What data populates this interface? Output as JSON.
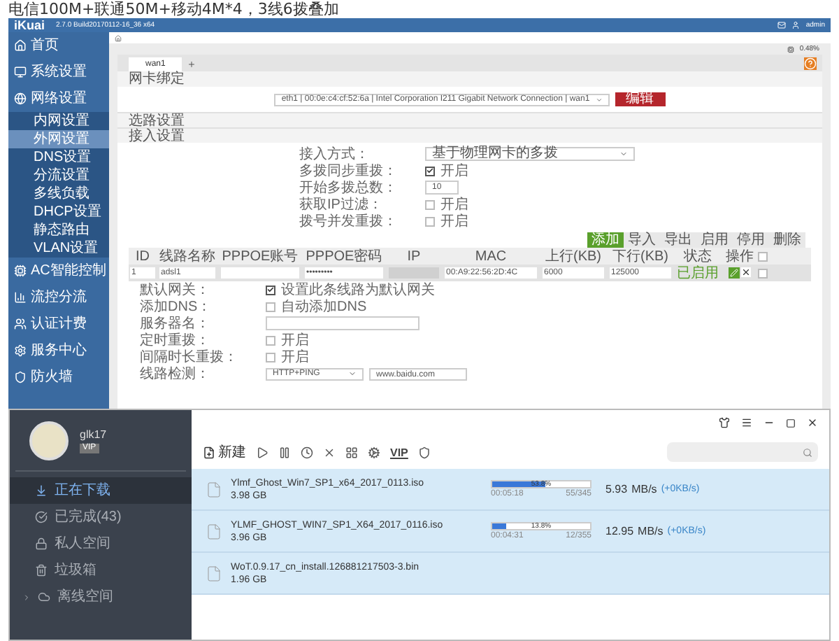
{
  "caption": "电信100M+联通50M+移动4M*4，3线6拨叠加",
  "router": {
    "header": {
      "logo": "iKuai",
      "version": "2.7.0 Build20170112-16_36 x64",
      "user": "admin"
    },
    "sidebar": [
      {
        "label": "首页",
        "kind": "main",
        "selected": false
      },
      {
        "label": "系统设置",
        "kind": "main",
        "selected": false
      },
      {
        "label": "网络设置",
        "kind": "main",
        "selected": false
      },
      {
        "label": "内网设置",
        "kind": "sub",
        "selected": false
      },
      {
        "label": "外网设置",
        "kind": "sub",
        "selected": true
      },
      {
        "label": "DNS设置",
        "kind": "sub",
        "selected": false
      },
      {
        "label": "分流设置",
        "kind": "sub",
        "selected": false
      },
      {
        "label": "多线负载",
        "kind": "sub",
        "selected": false
      },
      {
        "label": "DHCP设置",
        "kind": "sub",
        "selected": false
      },
      {
        "label": "静态路由",
        "kind": "sub",
        "selected": false
      },
      {
        "label": "VLAN设置",
        "kind": "sub",
        "selected": false
      },
      {
        "label": "AC智能控制",
        "kind": "main",
        "selected": false
      },
      {
        "label": "流控分流",
        "kind": "main",
        "selected": false
      },
      {
        "label": "认证计费",
        "kind": "main",
        "selected": false
      },
      {
        "label": "服务中心",
        "kind": "main",
        "selected": false
      },
      {
        "label": "防火墙",
        "kind": "main",
        "selected": false
      }
    ],
    "stats": {
      "cpu": "0.48%"
    },
    "tabs": [
      {
        "label": "wan1",
        "selected": true
      }
    ],
    "binding": {
      "title": "网卡绑定",
      "select": "eth1 | 00:0e:c4:cf:52:6a | Intel Corporation I211 Gigabit Network Connection | wan1",
      "button": "编辑"
    },
    "sections": [
      "选路设置",
      "接入设置"
    ],
    "form": [
      {
        "label": "接入方式：",
        "kind": "select",
        "value": "基于物理网卡的多拨"
      },
      {
        "label": "多拨同步重拨：",
        "kind": "checkbox",
        "checked": true,
        "text": "开启"
      },
      {
        "label": "开始多拨总数：",
        "kind": "number",
        "value": "10"
      },
      {
        "label": "获取IP过滤：",
        "kind": "checkbox",
        "checked": false,
        "text": "开启"
      },
      {
        "label": "拨号并发重拨：",
        "kind": "checkbox",
        "checked": false,
        "text": "开启"
      }
    ],
    "actions": [
      {
        "label": "添加",
        "primary": true
      },
      {
        "label": "导入",
        "primary": false
      },
      {
        "label": "导出",
        "primary": false
      },
      {
        "label": "启用",
        "primary": false
      },
      {
        "label": "停用",
        "primary": false
      },
      {
        "label": "删除",
        "primary": false
      }
    ],
    "columns": [
      "ID",
      "线路名称",
      "PPPOE账号",
      "PPPOE密码",
      "IP",
      "MAC",
      "上行(KB)",
      "下行(KB)",
      "状态",
      "操作"
    ],
    "header_checked": false,
    "row": {
      "id": "1",
      "name": "adsl1",
      "password": "•••••••••",
      "mac": "00:A9:22:56:2D:4C",
      "up": "6000",
      "down": "125000",
      "status": "已启用",
      "enabled": true,
      "checked": false
    },
    "detail": [
      {
        "label": "默认网关：",
        "kind": "checkbox",
        "checked": true,
        "text": "设置此条线路为默认网关"
      },
      {
        "label": "添加DNS：",
        "kind": "checkbox",
        "checked": false,
        "text": "自动添加DNS"
      },
      {
        "label": "服务器名：",
        "kind": "input"
      },
      {
        "label": "定时重拨：",
        "kind": "checkbox",
        "checked": false,
        "text": "开启"
      },
      {
        "label": "间隔时长重拨：",
        "kind": "checkbox",
        "checked": false,
        "text": "开启"
      },
      {
        "label": "线路检测：",
        "kind": "check",
        "value": "HTTP+PING",
        "target": "www.baidu.com"
      }
    ]
  },
  "downloader": {
    "user": {
      "name": "glk17",
      "badge": "VIP"
    },
    "nav": [
      {
        "label": "正在下载",
        "selected": true,
        "expandable": false
      },
      {
        "label": "已完成(43)",
        "selected": false,
        "expandable": false
      },
      {
        "label": "私人空间",
        "selected": false,
        "expandable": false
      },
      {
        "label": "垃圾箱",
        "selected": false,
        "expandable": false
      },
      {
        "label": "离线空间",
        "selected": false,
        "expandable": true
      }
    ],
    "toolbar": {
      "new": "新建",
      "vip": "VIP"
    },
    "tasks": [
      {
        "name": "Ylmf_Ghost_Win7_SP1_x64_2017_0113.iso",
        "size": "3.98 GB",
        "level": 0.538,
        "percent": "53.8%",
        "elapsed": "00:05:18",
        "pieces": "55/345",
        "speed": "5.93",
        "unit": "MB/s",
        "extra": "(+0KB/s)"
      },
      {
        "name": "YLMF_GHOST_WIN7_SP1_X64_2017_0116.iso",
        "size": "3.96 GB",
        "level": 0.138,
        "percent": "13.8%",
        "elapsed": "00:04:31",
        "pieces": "12/355",
        "speed": "12.95",
        "unit": "MB/s",
        "extra": "(+0KB/s)"
      },
      {
        "name": "WoT.0.9.17_cn_install.126881217503-3.bin",
        "size": "1.96 GB"
      }
    ]
  }
}
